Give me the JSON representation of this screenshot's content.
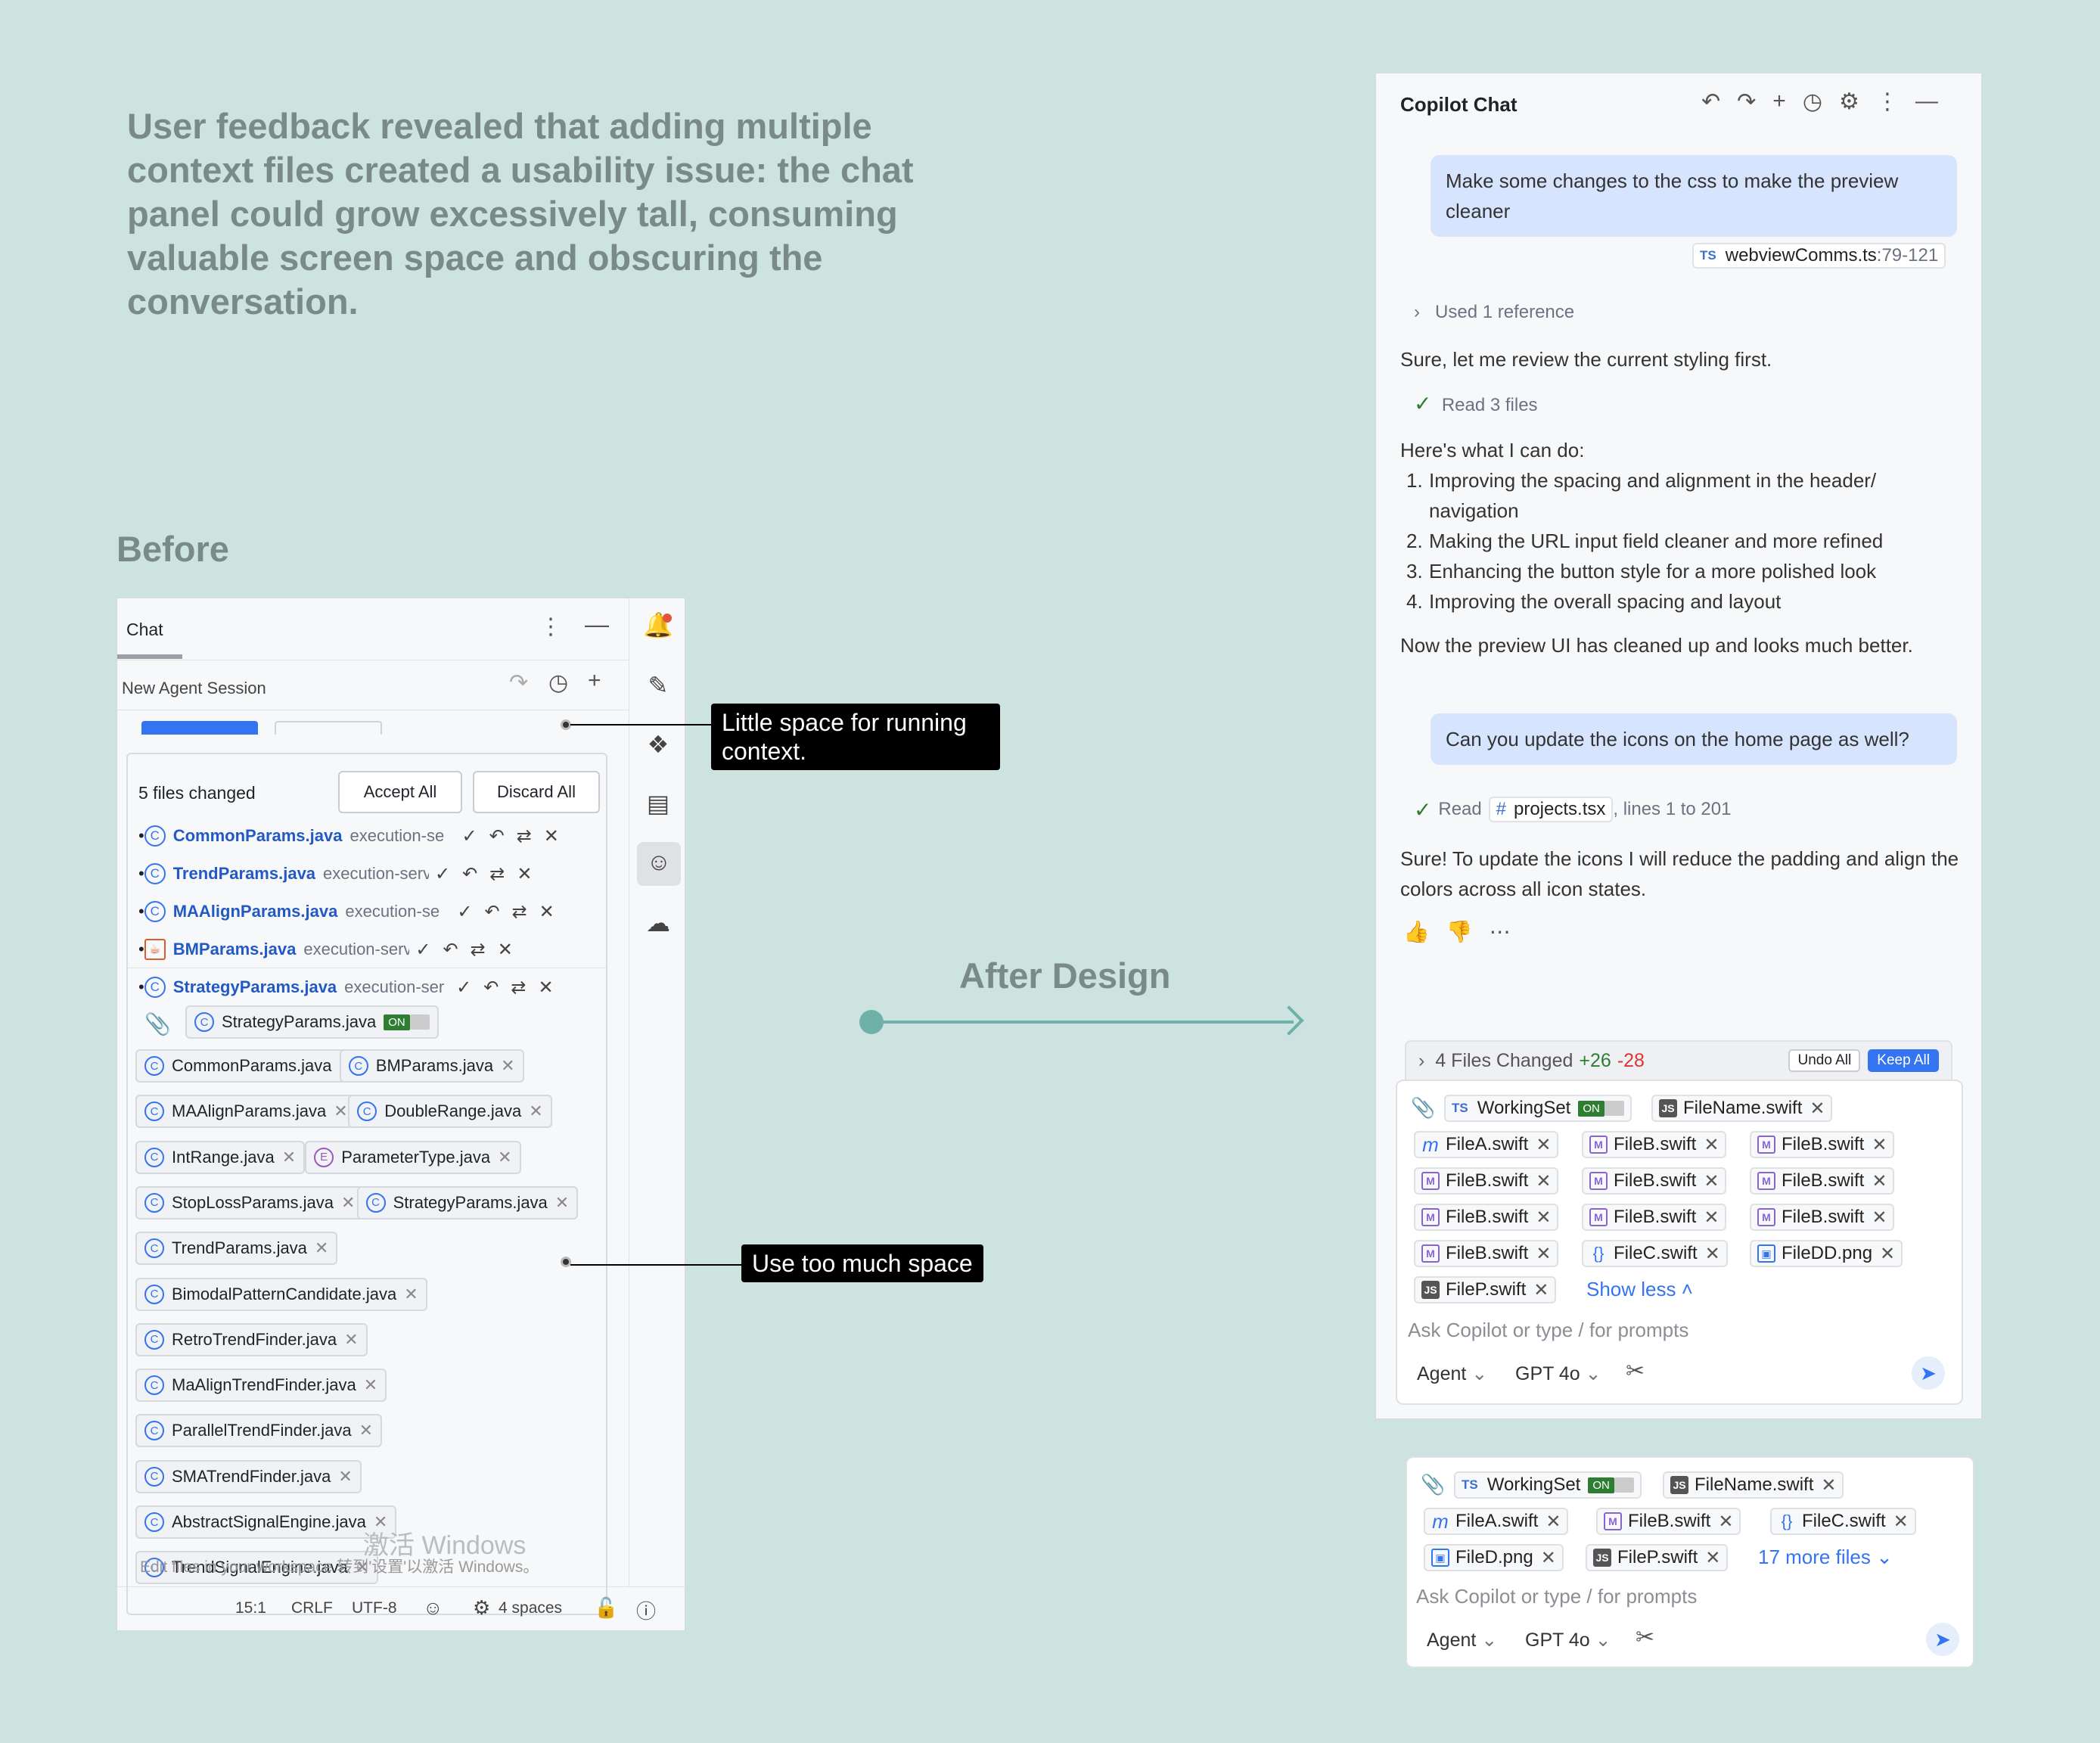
{
  "intro": "User feedback revealed that adding multiple context files created a usability issue: the chat panel could grow excessively tall, consuming valuable screen space and obscuring the conversation.",
  "labels": {
    "before": "Before",
    "after": "After Design"
  },
  "callouts": {
    "running": "Little space for running context.",
    "space": "Use too much space"
  },
  "before": {
    "tab": "Chat",
    "session": "New Agent Session",
    "files_changed": "5 files changed",
    "accept": "Accept All",
    "discard": "Discard All",
    "files": [
      {
        "name": "CommonParams.java",
        "path": "execution-se"
      },
      {
        "name": "TrendParams.java",
        "path": "execution-serve"
      },
      {
        "name": "MAAlignParams.java",
        "path": "execution-se"
      },
      {
        "name": "BMParams.java",
        "path": "execution-server\\s"
      },
      {
        "name": "StrategyParams.java",
        "path": "execution-ser"
      }
    ],
    "working": "StrategyParams.java",
    "on": "ON",
    "chips": [
      [
        "CommonParams.java",
        "BMParams.java"
      ],
      [
        "MAAlignParams.java",
        "DoubleRange.java"
      ],
      [
        "IntRange.java",
        "ParameterType.java"
      ],
      [
        "StopLossParams.java",
        "StrategyParams.java"
      ],
      [
        "TrendParams.java"
      ],
      [
        "BimodalPatternCandidate.java"
      ],
      [
        "RetroTrendFinder.java"
      ],
      [
        "MaAlignTrendFinder.java"
      ],
      [
        "ParallelTrendFinder.java"
      ],
      [
        "SMATrendFinder.java"
      ],
      [
        "AbstractSignalEngine.java"
      ],
      [
        "TrendSignalEngine.java"
      ]
    ],
    "watermark": "激活 Windows",
    "watermark2": "Edit files in your workspace 转到'设置'以激活 Windows。",
    "status": {
      "pos": "15:1",
      "crlf": "CRLF",
      "enc": "UTF-8",
      "indent": "4 spaces"
    }
  },
  "after": {
    "title": "Copilot Chat",
    "msg1": "Make some changes to the css to make the preview cleaner",
    "ref1_name": "webviewComms.ts",
    "ref1_lines": ":79-121",
    "used": "Used 1 reference",
    "review": "Sure, let me review the current styling first.",
    "read3": "Read 3 files",
    "can_do": "Here's what I can do:",
    "list": [
      "Improving the spacing and alignment in the header/ navigation",
      "Making the URL input field cleaner and more refined",
      "Enhancing the button style for a more polished look",
      "Improving the overall spacing and layout"
    ],
    "now": "Now the preview UI has cleaned up and looks much better.",
    "msg2": "Can you update the icons on the home page as well?",
    "read": "Read",
    "ref2": "projects.tsx",
    "ref2_lines": ", lines 1 to 201",
    "sure": "Sure! To update the icons I will reduce the padding and align the colors across all icon states.",
    "files_changed": "4 Files Changed",
    "plus": "+26",
    "minus": "-28",
    "undo": "Undo All",
    "keep": "Keep All",
    "working": "WorkingSet",
    "on": "ON",
    "filename": "FileName.swift",
    "chips": [
      [
        {
          "t": "sw",
          "n": "FileA.swift"
        },
        {
          "t": "m",
          "n": "FileB.swift"
        },
        {
          "t": "m",
          "n": "FileB.swift"
        }
      ],
      [
        {
          "t": "m",
          "n": "FileB.swift"
        },
        {
          "t": "m",
          "n": "FileB.swift"
        },
        {
          "t": "m",
          "n": "FileB.swift"
        }
      ],
      [
        {
          "t": "m",
          "n": "FileB.swift"
        },
        {
          "t": "m",
          "n": "FileB.swift"
        },
        {
          "t": "m",
          "n": "FileB.swift"
        }
      ],
      [
        {
          "t": "m",
          "n": "FileB.swift"
        },
        {
          "t": "br",
          "n": "FileC.swift"
        },
        {
          "t": "png",
          "n": "FileDD.png"
        }
      ]
    ],
    "filep": "FileP.swift",
    "show_less": "Show less",
    "placeholder": "Ask Copilot or type / for prompts",
    "agent": "Agent",
    "model": "GPT 4o"
  },
  "after2": {
    "working": "WorkingSet",
    "on": "ON",
    "filename": "FileName.swift",
    "r2": [
      {
        "t": "sw",
        "n": "FileA.swift"
      },
      {
        "t": "m",
        "n": "FileB.swift"
      },
      {
        "t": "br",
        "n": "FileC.swift"
      }
    ],
    "filed": "FileD.png",
    "filep": "FileP.swift",
    "more": "17 more files",
    "placeholder": "Ask Copilot or type / for prompts",
    "agent": "Agent",
    "model": "GPT 4o"
  }
}
